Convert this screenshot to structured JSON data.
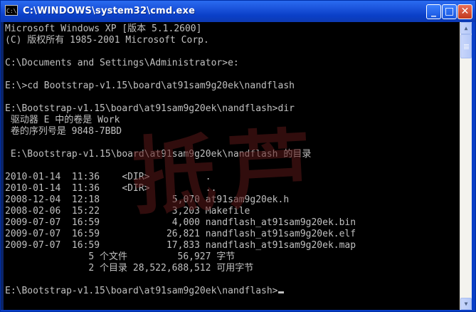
{
  "window": {
    "title": "C:\\WINDOWS\\system32\\cmd.exe",
    "icon_label": "C:\\",
    "buttons": {
      "minimize": "_",
      "maximize": "□",
      "close": "✕"
    }
  },
  "console": {
    "lines": [
      "Microsoft Windows XP [版本 5.1.2600]",
      "(C) 版权所有 1985-2001 Microsoft Corp.",
      "",
      "C:\\Documents and Settings\\Administrator>e:",
      "",
      "E:\\>cd Bootstrap-v1.15\\board\\at91sam9g20ek\\nandflash",
      "",
      "E:\\Bootstrap-v1.15\\board\\at91sam9g20ek\\nandflash>dir",
      " 驱动器 E 中的卷是 Work",
      " 卷的序列号是 9848-7BBD",
      "",
      " E:\\Bootstrap-v1.15\\board\\at91sam9g20ek\\nandflash 的目录",
      "",
      "2010-01-14  11:36    <DIR>          .",
      "2010-01-14  11:36    <DIR>          ..",
      "2008-12-04  12:18             5,070 at91sam9g20ek.h",
      "2008-02-06  15:22             3,203 Makefile",
      "2009-07-07  16:59             4,000 nandflash_at91sam9g20ek.bin",
      "2009-07-07  16:59            26,821 nandflash_at91sam9g20ek.elf",
      "2009-07-07  16:59            17,833 nandflash_at91sam9g20ek.map",
      "               5 个文件         56,927 字节",
      "               2 个目录 28,522,688,512 可用字节",
      "",
      "E:\\Bootstrap-v1.15\\board\\at91sam9g20ek\\nandflash>"
    ]
  },
  "watermark": "抵芦",
  "scrollbar": {
    "up_icon": "up-arrow-icon",
    "down_icon": "down-arrow-icon"
  },
  "colors": {
    "titlebar": "#0a3fc7",
    "console_bg": "#000000",
    "console_text": "#c0c0c0",
    "watermark": "#5a1818"
  }
}
